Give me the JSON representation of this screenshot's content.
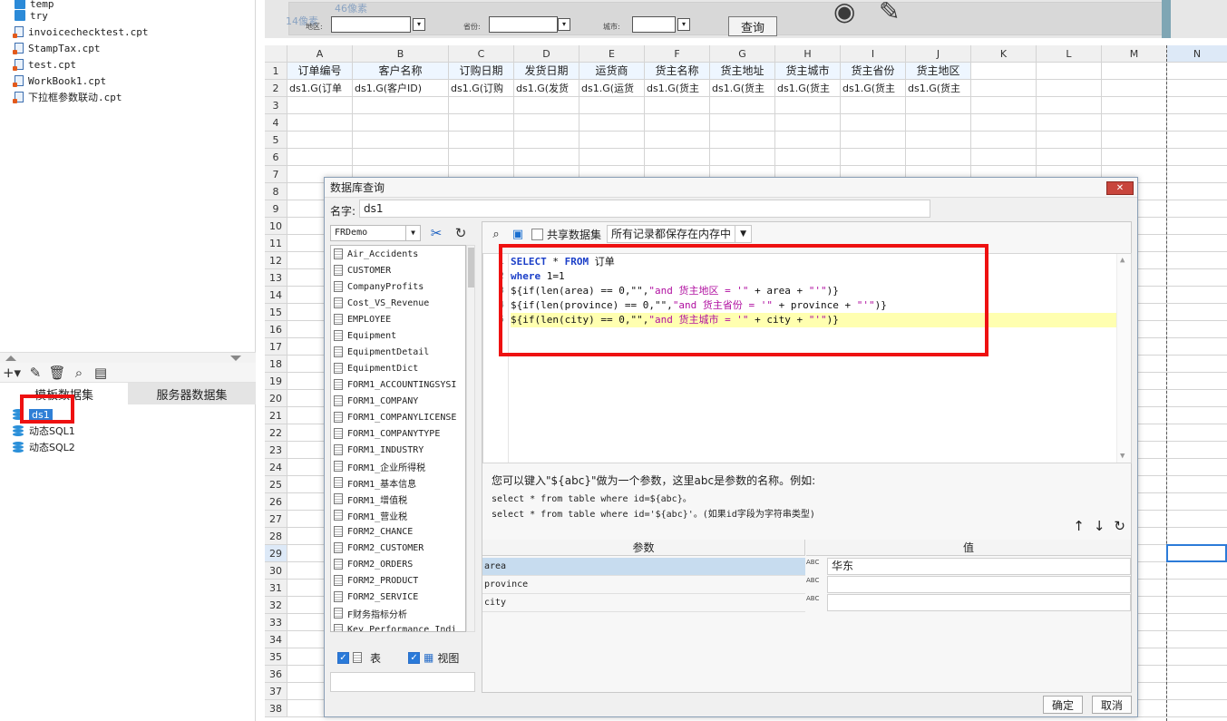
{
  "left_panel": {
    "files": [
      {
        "name": "temp",
        "icon": "folder-icon"
      },
      {
        "name": "try",
        "icon": "folder-icon"
      },
      {
        "name": "invoicechecktest.cpt",
        "icon": "report-file-icon"
      },
      {
        "name": "StampTax.cpt",
        "icon": "report-file-icon"
      },
      {
        "name": "test.cpt",
        "icon": "report-file-icon"
      },
      {
        "name": "WorkBook1.cpt",
        "icon": "report-file-icon"
      },
      {
        "name": "下拉框参数联动.cpt",
        "icon": "report-file-icon"
      }
    ],
    "tabs": [
      "模板数据集",
      "服务器数据集"
    ],
    "datasets": [
      "ds1",
      "动态SQL1",
      "动态SQL2"
    ]
  },
  "param_bar": {
    "ruler_top": "46像素",
    "ruler_left": "14像素",
    "area_label": "地区:",
    "province_label": "省份:",
    "city_label": "城市:",
    "query_button": "查询"
  },
  "sheet": {
    "columns": [
      "A",
      "B",
      "C",
      "D",
      "E",
      "F",
      "G",
      "H",
      "I",
      "J",
      "K",
      "L",
      "M",
      "N"
    ],
    "rows": [
      "1",
      "2",
      "3",
      "4",
      "5",
      "6",
      "7",
      "8",
      "9",
      "10",
      "11",
      "12",
      "13",
      "14",
      "15",
      "16",
      "17",
      "18",
      "19",
      "20",
      "21",
      "22",
      "23",
      "24",
      "25",
      "26",
      "27",
      "28",
      "29",
      "30",
      "31",
      "32",
      "33",
      "34",
      "35",
      "36",
      "37",
      "38"
    ],
    "header_row": [
      "订单编号",
      "客户名称",
      "订购日期",
      "发货日期",
      "运货商",
      "货主名称",
      "货主地址",
      "货主城市",
      "货主省份",
      "货主地区"
    ],
    "data_row": [
      "ds1.G(订单",
      "ds1.G(客户ID)",
      "ds1.G(订购",
      "ds1.G(发货",
      "ds1.G(运货",
      "ds1.G(货主",
      "ds1.G(货主",
      "ds1.G(货主",
      "ds1.G(货主",
      "ds1.G(货主"
    ]
  },
  "dialog": {
    "title": "数据库查询",
    "name_label": "名字:",
    "name_value": "ds1",
    "connection": "FRDemo",
    "tables": [
      "Air_Accidents",
      "CUSTOMER",
      "CompanyProfits",
      "Cost_VS_Revenue",
      "EMPLOYEE",
      "Equipment",
      "EquipmentDetail",
      "EquipmentDict",
      "FORM1_ACCOUNTINGSYSI",
      "FORM1_COMPANY",
      "FORM1_COMPANYLICENSE",
      "FORM1_COMPANYTYPE",
      "FORM1_INDUSTRY",
      "FORM1_企业所得税",
      "FORM1_基本信息",
      "FORM1_增值税",
      "FORM1_营业税",
      "FORM2_CHANCE",
      "FORM2_CUSTOMER",
      "FORM2_ORDERS",
      "FORM2_PRODUCT",
      "FORM2_SERVICE",
      "F财务指标分析",
      "Key_Performance_Indi"
    ],
    "filter_table": "表",
    "filter_view": "视图",
    "share_label": "共享数据集",
    "memory_option": "所有记录都保存在内存中",
    "sql": {
      "l1_kw1": "SELECT",
      "l1_star": " * ",
      "l1_kw2": "FROM",
      "l1_rest": " 订单",
      "l2_kw": "where",
      "l2_rest": " 1=1",
      "l3_a": "${if(len(area) == 0,\"\",",
      "l3_s": "\"and 货主地区 = '\"",
      "l3_b": " + area + ",
      "l3_s2": "\"'\"",
      "l3_c": ")}",
      "l4_a": "${if(len(province) == 0,\"\",",
      "l4_s": "\"and 货主省份 = '\"",
      "l4_b": " + province + ",
      "l4_s2": "\"'\"",
      "l4_c": ")}",
      "l5_a": "${if(len(city) == 0,\"\",",
      "l5_s": "\"and 货主城市 = '\"",
      "l5_b": " + city + ",
      "l5_s2": "\"'\"",
      "l5_c": ")}"
    },
    "line_numbers": [
      "1",
      "2",
      "3",
      "4",
      "5"
    ],
    "hint_line1": "您可以键入\"${abc}\"做为一个参数，这里abc是参数的名称。例如:",
    "hint_line2": "select * from table where id=${abc}。",
    "hint_line3": "select * from table where id='${abc}'。(如果id字段为字符串类型)",
    "param_header": "参数",
    "value_header": "值",
    "params": [
      {
        "name": "area",
        "value": "华东"
      },
      {
        "name": "province",
        "value": ""
      },
      {
        "name": "city",
        "value": ""
      }
    ],
    "type_icon_text": "ABC",
    "ok": "确定",
    "cancel": "取消"
  },
  "colors": {
    "highlight_red": "#ee1111",
    "selection_blue": "#2f7fd6",
    "sql_keyword": "#1b3fc8",
    "sql_string": "#b00fa0",
    "current_line": "#ffffb0"
  }
}
